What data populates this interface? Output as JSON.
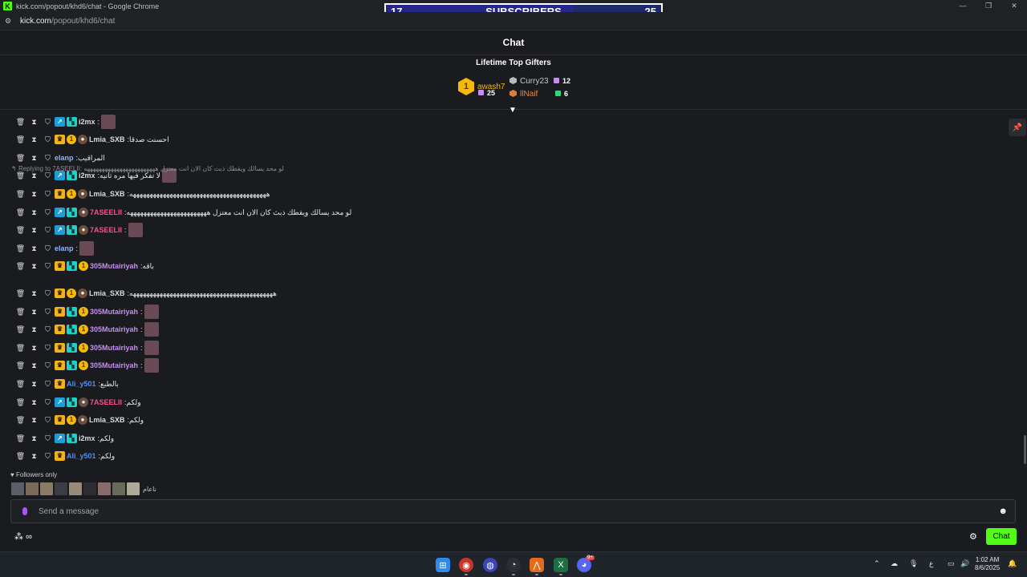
{
  "browser": {
    "title": "kick.com/popout/khd6/chat - Google Chrome",
    "url_host": "kick.com",
    "url_path": "/popout/khd6/chat",
    "controls": [
      "—",
      "❐",
      "✕"
    ]
  },
  "subscribers_bar": {
    "current": "17",
    "label": "SUBSCRIBERS",
    "goal": "25",
    "progress_fraction": 0.68
  },
  "header": {
    "title": "Chat"
  },
  "gifters": {
    "title": "Lifetime Top Gifters",
    "first": {
      "rank": "1",
      "name": "awash7",
      "count": "25"
    },
    "second": {
      "name": "Curry23",
      "count": "12"
    },
    "third": {
      "name": "llNaif",
      "count": "6"
    }
  },
  "messages": [
    {
      "user": "i2mx",
      "color": "#d9dce1",
      "badges": [
        "blue",
        "cyan"
      ],
      "text": "",
      "emote": true
    },
    {
      "user": "Lmia_SXB",
      "color": "#d9dce1",
      "badges": [
        "crown",
        "one",
        "bot"
      ],
      "text": "احسنت صدقا",
      "emote": false
    },
    {
      "user": "elanp",
      "color": "#8fb6ff",
      "badges": [],
      "text": "المراقيب",
      "emote": false
    },
    {
      "user": "i2mx",
      "color": "#d9dce1",
      "badges": [
        "blue",
        "cyan"
      ],
      "text": "لا تفكر فيها مره ثانيه",
      "emote": true
    },
    {
      "user": "Lmia_SXB",
      "color": "#d9dce1",
      "badges": [
        "crown",
        "one",
        "bot"
      ],
      "text": "هههههههههههههههههههههههههههههههههههههههههه",
      "emote": false
    },
    {
      "user": "7ASEELII",
      "color": "#f0568a",
      "badges": [
        "blue",
        "cyan",
        "bot"
      ],
      "text": "لو محد يسالك ويقطك ذبث كان الان انت معتزل ههههههههههههههههههههههههه",
      "emote": false
    },
    {
      "user": "7ASEELII",
      "color": "#f0568a",
      "badges": [
        "blue",
        "cyan",
        "bot"
      ],
      "text": "",
      "emote": true
    },
    {
      "user": "elanp",
      "color": "#8fb6ff",
      "badges": [],
      "text": "",
      "emote": true
    },
    {
      "user": "305Mutairiyah",
      "color": "#c58ef0",
      "badges": [
        "crown",
        "cyan",
        "one"
      ],
      "text": "باقه",
      "emote": false
    },
    {
      "user": "Lmia_SXB",
      "color": "#d9dce1",
      "badges": [
        "crown",
        "one",
        "bot"
      ],
      "text": "هههههههههههههههههههههههههههههههههههههههههههه",
      "emote": false
    },
    {
      "user": "305Mutairiyah",
      "color": "#c58ef0",
      "badges": [
        "crown",
        "cyan",
        "one"
      ],
      "text": "",
      "emote": true
    },
    {
      "user": "305Mutairiyah",
      "color": "#c58ef0",
      "badges": [
        "crown",
        "cyan",
        "one"
      ],
      "text": "",
      "emote": true
    },
    {
      "user": "305Mutairiyah",
      "color": "#c58ef0",
      "badges": [
        "crown",
        "cyan",
        "one"
      ],
      "text": "",
      "emote": true
    },
    {
      "user": "305Mutairiyah",
      "color": "#c58ef0",
      "badges": [
        "crown",
        "cyan",
        "one"
      ],
      "text": "",
      "emote": true
    },
    {
      "user": "Ali_y501",
      "color": "#4b8ff7",
      "badges": [
        "crown"
      ],
      "text": "بالطبع",
      "emote": false
    },
    {
      "user": "7ASEELII",
      "color": "#f0568a",
      "badges": [
        "blue",
        "cyan",
        "bot"
      ],
      "text": "ولكم",
      "emote": false
    },
    {
      "user": "Lmia_SXB",
      "color": "#d9dce1",
      "badges": [
        "crown",
        "one",
        "bot"
      ],
      "text": "ولكم",
      "emote": false
    },
    {
      "user": "i2mx",
      "color": "#d9dce1",
      "badges": [
        "blue",
        "cyan"
      ],
      "text": "ولكم",
      "emote": false
    },
    {
      "user": "Ali_y501",
      "color": "#4b8ff7",
      "badges": [
        "crown"
      ],
      "text": "ولكم",
      "emote": false
    }
  ],
  "reply": {
    "prefix": "Replying to 7ASEELII:",
    "text": "لو محد يسالك ويقطك ذبث كان الان انت معتزل ههههههههههههههههههههههههه"
  },
  "followers_only": "Followers only",
  "follower_name": "ناعام",
  "input": {
    "placeholder": "Send a message"
  },
  "chat_button": "Chat",
  "taskbar": {
    "time": "1:02 AM",
    "date": "8/6/2025",
    "lang": "ع",
    "discord_badge": "9+"
  }
}
